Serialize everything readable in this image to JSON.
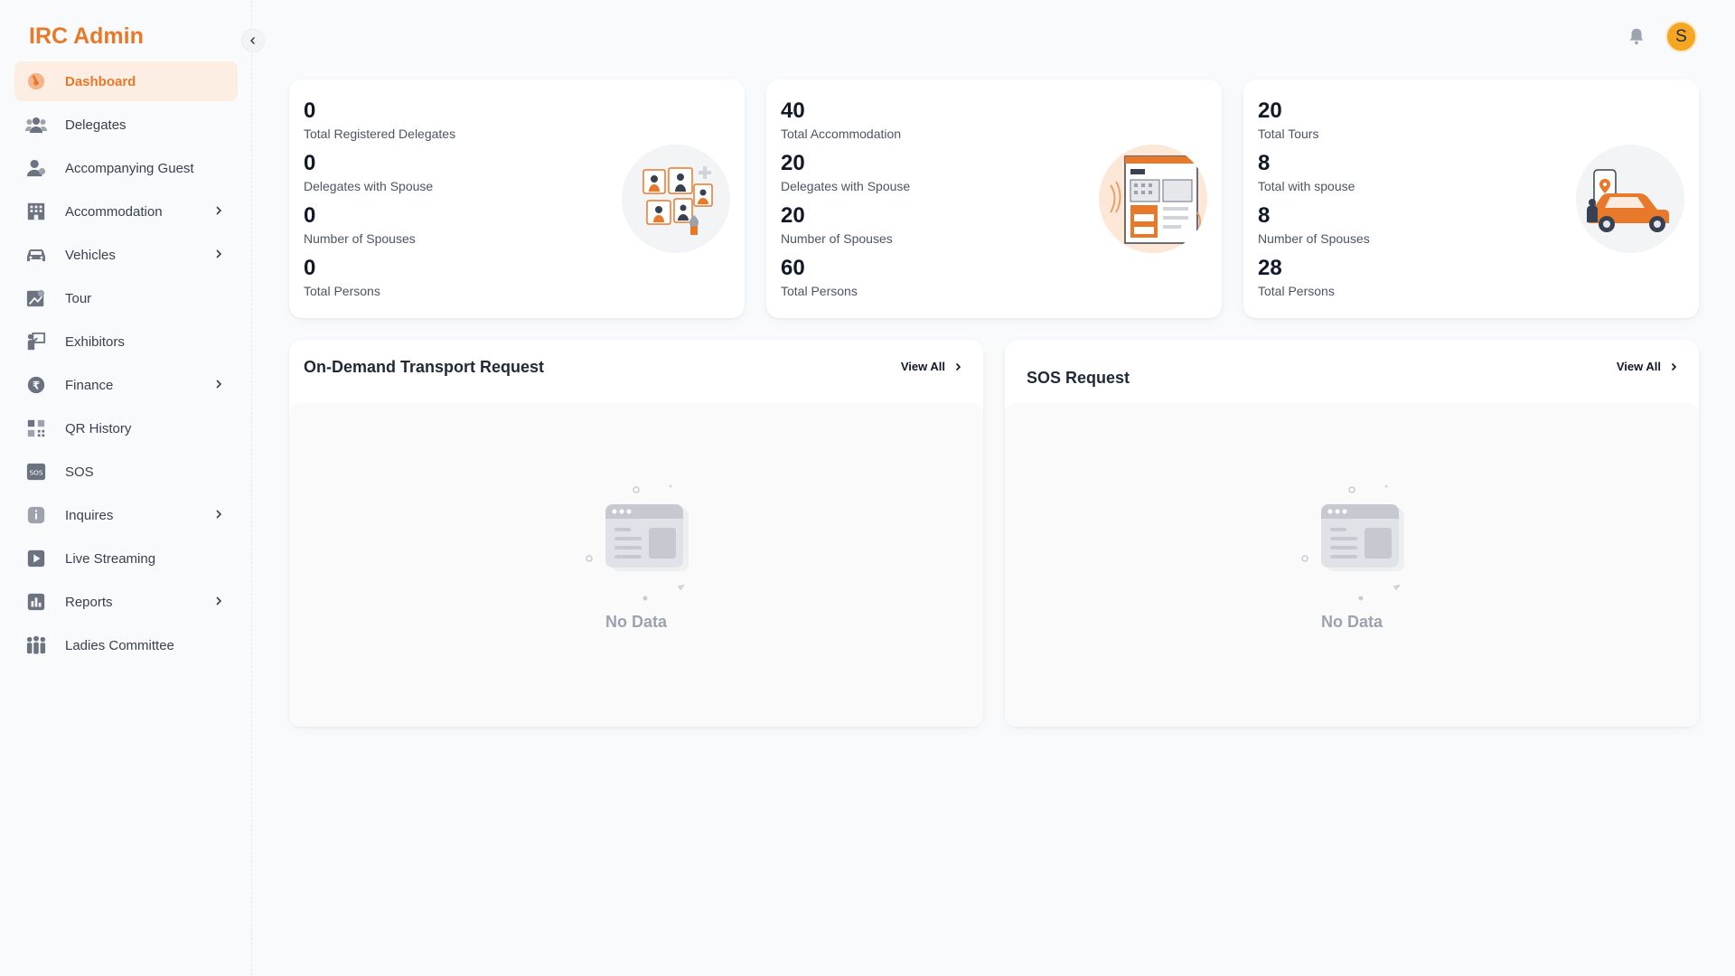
{
  "app": {
    "brand": "IRC Admin"
  },
  "header": {
    "avatar_letter": "S"
  },
  "sidebar": {
    "items": [
      {
        "label": "Dashboard",
        "icon": "dashboard-icon",
        "active": true,
        "has_chevron": false
      },
      {
        "label": "Delegates",
        "icon": "users-icon",
        "has_chevron": false
      },
      {
        "label": "Accompanying Guest",
        "icon": "guest-icon",
        "has_chevron": false
      },
      {
        "label": "Accommodation",
        "icon": "building-icon",
        "has_chevron": true
      },
      {
        "label": "Vehicles",
        "icon": "car-icon",
        "has_chevron": true
      },
      {
        "label": "Tour",
        "icon": "tour-map-icon",
        "has_chevron": false
      },
      {
        "label": "Exhibitors",
        "icon": "exhibitor-icon",
        "has_chevron": false
      },
      {
        "label": "Finance",
        "icon": "rupee-icon",
        "has_chevron": true
      },
      {
        "label": "QR History",
        "icon": "qr-icon",
        "has_chevron": false
      },
      {
        "label": "SOS",
        "icon": "sos-icon",
        "has_chevron": false
      },
      {
        "label": "Inquires",
        "icon": "info-icon",
        "has_chevron": true
      },
      {
        "label": "Live Streaming",
        "icon": "play-icon",
        "has_chevron": false
      },
      {
        "label": "Reports",
        "icon": "bar-chart-icon",
        "has_chevron": true
      },
      {
        "label": "Ladies Committee",
        "icon": "group-icon",
        "has_chevron": false
      }
    ]
  },
  "cards": [
    {
      "stats": [
        {
          "value": "0",
          "label": "Total Registered Delegates"
        },
        {
          "value": "0",
          "label": "Delegates with Spouse"
        },
        {
          "value": "0",
          "label": "Number of Spouses"
        },
        {
          "value": "0",
          "label": "Total Persons"
        }
      ]
    },
    {
      "stats": [
        {
          "value": "40",
          "label": "Total Accommodation"
        },
        {
          "value": "20",
          "label": "Delegates with Spouse"
        },
        {
          "value": "20",
          "label": "Number of Spouses"
        },
        {
          "value": "60",
          "label": "Total Persons"
        }
      ]
    },
    {
      "stats": [
        {
          "value": "20",
          "label": "Total Tours"
        },
        {
          "value": "8",
          "label": "Total with spouse"
        },
        {
          "value": "8",
          "label": "Number of Spouses"
        },
        {
          "value": "28",
          "label": "Total Persons"
        }
      ]
    }
  ],
  "panels": {
    "transport": {
      "title": "On-Demand Transport Request",
      "view_all": "View All",
      "empty": "No Data"
    },
    "sos": {
      "title": "SOS Request",
      "view_all": "View All",
      "empty": "No Data"
    }
  },
  "colors": {
    "accent": "#e8782a",
    "active_bg": "#fdeee4",
    "avatar": "#f5a623"
  }
}
